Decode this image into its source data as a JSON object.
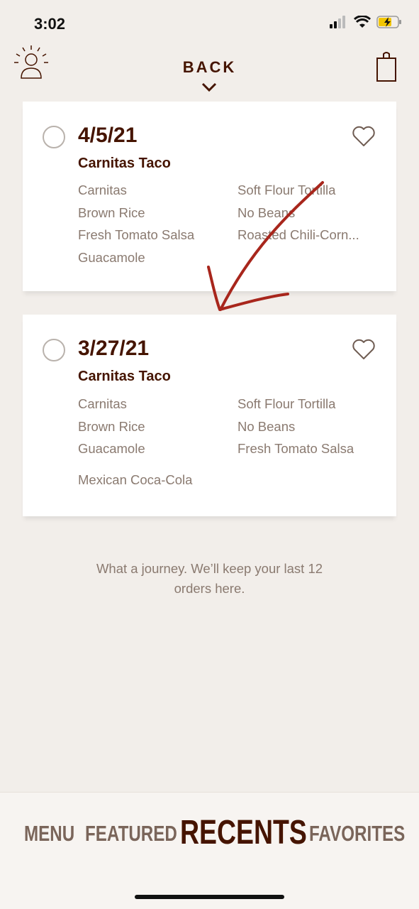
{
  "status_bar": {
    "time": "3:02"
  },
  "header": {
    "back_label": "BACK"
  },
  "orders": [
    {
      "date": "4/5/21",
      "item": "Carnitas Taco",
      "ingredients_left": [
        "Carnitas",
        "Brown Rice",
        "Fresh Tomato Salsa",
        "Guacamole"
      ],
      "ingredients_right": [
        "Soft Flour Tortilla",
        "No Beans",
        "Roasted Chili-Corn..."
      ]
    },
    {
      "date": "3/27/21",
      "item": "Carnitas Taco",
      "ingredients_left": [
        "Carnitas",
        "Brown Rice",
        "Guacamole"
      ],
      "ingredients_right": [
        "Soft Flour Tortilla",
        "No Beans",
        "Fresh Tomato Salsa"
      ],
      "extra": "Mexican Coca-Cola"
    }
  ],
  "footer_note": [
    "What a journey. We’ll keep your last 12",
    "orders here."
  ],
  "bottom_nav": {
    "menu": "MENU",
    "featured": "FEATURED",
    "recents": "RECENTS",
    "favorites": "FAVORITES",
    "active": "RECENTS"
  },
  "colors": {
    "background": "#f2eeea",
    "brand_brown": "#451400",
    "muted_text": "#8a7a70",
    "annotation_arrow": "#a8261c"
  },
  "icons": [
    "account-icon",
    "chevron-down-icon",
    "bag-icon",
    "heart-icon",
    "radio-icon"
  ]
}
